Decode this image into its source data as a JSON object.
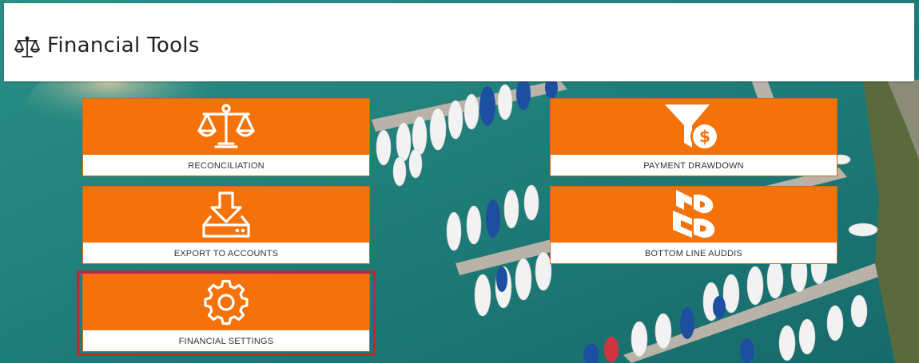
{
  "header": {
    "title": "Financial Tools",
    "icon": "scales-icon"
  },
  "colors": {
    "tile_orange": "#f5720a",
    "highlight_red": "#c1272d",
    "strip_blue": "#1aa3dd",
    "strip_orange": "#f0960f"
  },
  "tiles": [
    {
      "label": "RECONCILIATION",
      "icon": "scales-icon"
    },
    {
      "label": "PAYMENT DRAWDOWN",
      "icon": "funnel-dollar-icon"
    },
    {
      "label": "EXPORT TO ACCOUNTS",
      "icon": "download-tray-icon"
    },
    {
      "label": "BOTTOM LINE AUDDIS",
      "icon": "bottomline-logo-icon"
    },
    {
      "label": "FINANCIAL SETTINGS",
      "icon": "gear-icon",
      "highlighted": true
    }
  ]
}
